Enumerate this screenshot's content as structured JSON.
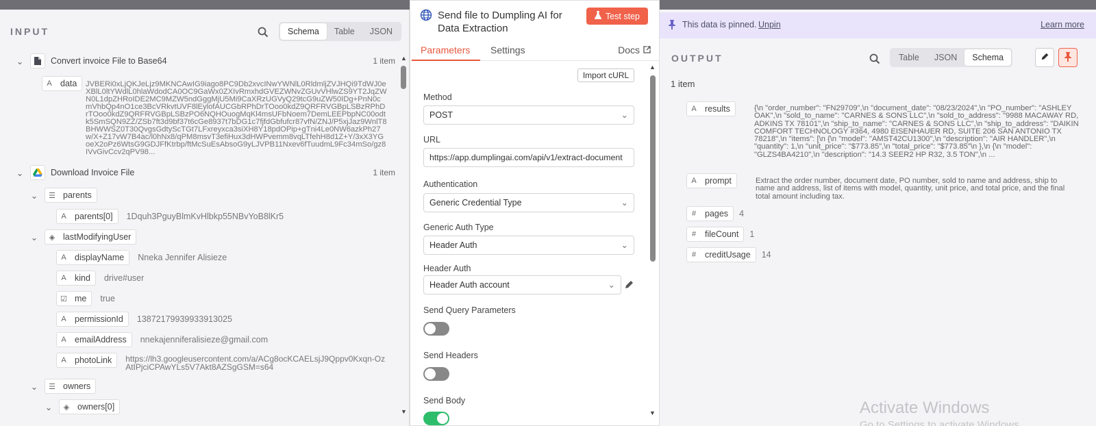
{
  "input": {
    "title": "INPUT",
    "view_modes": [
      "Schema",
      "Table",
      "JSON"
    ],
    "active_mode": "Schema",
    "nodes": [
      {
        "name": "Convert invoice File to Base64",
        "count": "1 item"
      },
      {
        "name": "Download Invoice File",
        "count": "1 item"
      }
    ],
    "data_key": "data",
    "data_value": "JVBERi0xLjQKJeLjz9MKNCAwIG9iago8PC9Db2xvcINwYWNlL0RldmljZVJHQi9TdWJ0eXBlL0ltYWdlL0hlaWdodCA0OC9GaWx0ZXIvRmxhdGVEZWNvZGUvVHlwZS9YT2JqZWN0L1dpZHRoIDE2MC9MZW5ndGggMjU5Mi9CaXRzUGVyQ29tcG9uZW50IDg+PnN0cmVhbQp4nO1ce3BcVRkvtUVF8lEylofAUCGbRPhDrTOoo0kdZ9QRFRVGBpLSBzRPhDrTOoo0kdZ9QRFRVGBpLSBzPO6NQHOuogMqKl4msUFbNoem7DemLEEPbpNC00odtk5SmSQN9ZZ/ZSb7ft3d9bf37t6cGe8937t7bDG1c7fjfdGbfufcr87vfN/ZNJ/P5xjJaz9WnlT8BHWWSZ0T30QvgsGdtyScTGt7LFxreyxca3siXH8Y18pdOPip+gTni4Le0NW6azkPh27w/X+Z17vW7B4ac/l0hNx8/qPM8msvT3efiHux3dHWPvemm8vqLTfehH8d1Z+Y/3xX3YGoeX2oPz6WtsG9GDJFfKtrbp/ftMcSuEsAbsoG9yLJVPB11Nxev6fTuudmL9Fc34mSo/gz8IVvGivCcv2qPV98...",
    "parents_key": "parents",
    "parents0_key": "parents[0]",
    "parents0_value": "1Dquh3PguyBlmKvHlbkp55NBvYoB8lKr5",
    "lmu_key": "lastModifyingUser",
    "fields": [
      {
        "icon": "A",
        "key": "displayName",
        "value": "Nneka Jennifer Alisieze"
      },
      {
        "icon": "A",
        "key": "kind",
        "value": "drive#user"
      },
      {
        "icon": "☑",
        "key": "me",
        "value": "true"
      },
      {
        "icon": "A",
        "key": "permissionId",
        "value": "13872179939933913025"
      },
      {
        "icon": "A",
        "key": "emailAddress",
        "value": "nnekajenniferalisieze@gmail.com"
      },
      {
        "icon": "A",
        "key": "photoLink",
        "value": "https://lh3.googleusercontent.com/a/ACg8ocKCAELsjJ9Qppv0Kxqn-OzAtIPjciCPAwYLs5V7Akt8AZSgGSM=s64"
      }
    ],
    "owners_key": "owners",
    "owners0_key": "owners[0]"
  },
  "node": {
    "title": "Send file to Dumpling AI for Data Extraction",
    "test_step": "Test step",
    "tabs": [
      "Parameters",
      "Settings"
    ],
    "docs": "Docs",
    "import_curl": "Import cURL",
    "method_label": "Method",
    "method_value": "POST",
    "url_label": "URL",
    "url_value": "https://app.dumplingai.com/api/v1/extract-document",
    "auth_label": "Authentication",
    "auth_value": "Generic Credential Type",
    "gat_label": "Generic Auth Type",
    "gat_value": "Header Auth",
    "ha_label": "Header Auth",
    "ha_value": "Header Auth account",
    "query_label": "Send Query Parameters",
    "headers_label": "Send Headers",
    "body_label": "Send Body",
    "toggles": {
      "query": false,
      "headers": false,
      "body": true
    }
  },
  "output": {
    "pinned_text": "This data is pinned.",
    "unpin": "Unpin",
    "learn_more": "Learn more",
    "title": "OUTPUT",
    "view_modes": [
      "Table",
      "JSON",
      "Schema"
    ],
    "active_mode": "Schema",
    "items_count": "1 item",
    "fields": [
      {
        "icon": "A",
        "key": "results",
        "value": "{\\n \"order_number\": \"FN29709\",\\n \"document_date\": \"08/23/2024\",\\n \"PO_number\": \"ASHLEY OAK\",\\n \"sold_to_name\": \"CARNES & SONS LLC\",\\n \"sold_to_address\": \"9988 MACAWAY RD, ADKINS TX 78101\",\\n \"ship_to_name\": \"CARNES & SONS LLC\",\\n \"ship_to_address\": \"DAIKIN COMFORT TECHNOLOGY #364, 4980 EISENHAUER RD, SUITE 206 SAN ANTONIO TX 78218\",\\n \"items\": [\\n {\\n \"model\": \"AMST42CU1300\",\\n \"description\": \"AIR HANDLER\",\\n \"quantity\": 1,\\n \"unit_price\": \"$773.85\",\\n \"total_price\": \"$773.85\"\\n },\\n {\\n \"model\": \"GLZS4BA4210\",\\n \"description\": \"14.3 SEER2 HP R32, 3.5 TON\",\\n ..."
      },
      {
        "icon": "A",
        "key": "prompt",
        "value": "Extract the order number, document date, PO number, sold to name and address, ship to name and address, list of items with model, quantity, unit price, and total price, and the final total amount including tax."
      },
      {
        "icon": "#",
        "key": "pages",
        "value": "4"
      },
      {
        "icon": "#",
        "key": "fileCount",
        "value": "1"
      },
      {
        "icon": "#",
        "key": "creditUsage",
        "value": "14"
      }
    ]
  },
  "watermark": {
    "line1": "Activate Windows",
    "line2": "Go to Settings to activate Windows."
  },
  "colors": {
    "accent": "#e8583e",
    "test_btn": "#f0624a",
    "pinned_bg": "#e9e4fb",
    "toggle_on": "#2ebd6b",
    "toggle_off": "#888888"
  }
}
